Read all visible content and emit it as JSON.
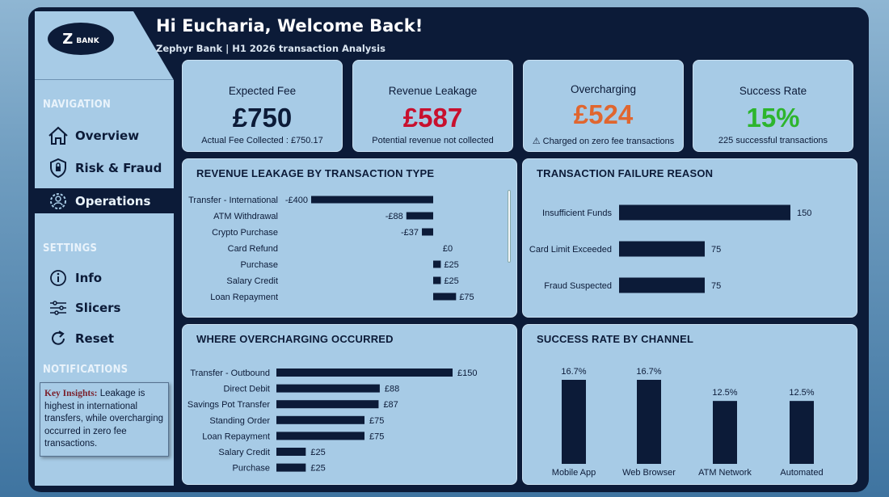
{
  "header": {
    "title": "Hi Eucharia, Welcome Back!",
    "subtitle": "Zephyr Bank | H1 2026 transaction Analysis"
  },
  "logo": {
    "mark": "Z",
    "text": "BANK"
  },
  "sidebar": {
    "navigation_title": "NAVIGATION",
    "nav": [
      {
        "label": "Overview",
        "icon": "home-icon"
      },
      {
        "label": "Risk & Fraud",
        "icon": "shield-icon"
      },
      {
        "label": "Operations",
        "icon": "gear-people-icon",
        "active": true
      }
    ],
    "settings_title": "SETTINGS",
    "settings": [
      {
        "label": "Info",
        "icon": "info-icon"
      },
      {
        "label": "Slicers",
        "icon": "sliders-icon"
      },
      {
        "label": "Reset",
        "icon": "reset-icon"
      }
    ],
    "notifications_title": "NOTIFICATIONS",
    "insight_title": "Key Insights:",
    "insight_text": " Leakage is highest in international transfers, while overcharging occurred in zero fee transactions."
  },
  "kpis": [
    {
      "label": "Expected Fee",
      "value": "£750",
      "sub": "Actual Fee Collected : £750.17",
      "color": "#0c1b38"
    },
    {
      "label": "Revenue Leakage",
      "value": "£587",
      "sub": "Potential revenue not collected",
      "color": "#c8102e"
    },
    {
      "label": "Overcharging",
      "value": "£524",
      "sub": "⚠ Charged on zero fee transactions",
      "color": "#e0662f"
    },
    {
      "label": "Success Rate",
      "value": "15%",
      "sub": "225 successful transactions",
      "color": "#2db52d"
    }
  ],
  "colors": {
    "bar": "#0c1b38",
    "panel_bg": "#a7cbe6",
    "frame": "#0c1b38"
  },
  "chart_data": [
    {
      "type": "bar",
      "orientation": "horizontal",
      "title": "REVENUE LEAKAGE BY TRANSACTION TYPE",
      "categories": [
        "Transfer - International",
        "ATM Withdrawal",
        "Crypto Purchase",
        "Card Refund",
        "Purchase",
        "Salary Credit",
        "Loan Repayment"
      ],
      "values": [
        -400,
        -88,
        -37,
        0,
        25,
        25,
        75
      ],
      "labels": [
        "-£400",
        "-£88",
        "-£37",
        "£0",
        "£25",
        "£25",
        "£75"
      ]
    },
    {
      "type": "bar",
      "orientation": "horizontal",
      "title": "TRANSACTION FAILURE REASON",
      "categories": [
        "Insufficient Funds",
        "Card Limit Exceeded",
        "Fraud Suspected"
      ],
      "values": [
        150,
        75,
        75
      ],
      "labels": [
        "150",
        "75",
        "75"
      ]
    },
    {
      "type": "bar",
      "orientation": "horizontal",
      "title": "WHERE OVERCHARGING OCCURRED",
      "categories": [
        "Transfer - Outbound",
        "Direct Debit",
        "Savings Pot Transfer",
        "Standing Order",
        "Loan Repayment",
        "Salary Credit",
        "Purchase"
      ],
      "values": [
        150,
        88,
        87,
        75,
        75,
        25,
        25
      ],
      "labels": [
        "£150",
        "£88",
        "£87",
        "£75",
        "£75",
        "£25",
        "£25"
      ]
    },
    {
      "type": "bar",
      "orientation": "vertical",
      "title": "SUCCESS RATE BY CHANNEL",
      "categories": [
        "Mobile App",
        "Web Browser",
        "ATM Network",
        "Automated"
      ],
      "values": [
        16.7,
        16.7,
        12.5,
        12.5
      ],
      "labels": [
        "16.7%",
        "16.7%",
        "12.5%",
        "12.5%"
      ]
    }
  ]
}
